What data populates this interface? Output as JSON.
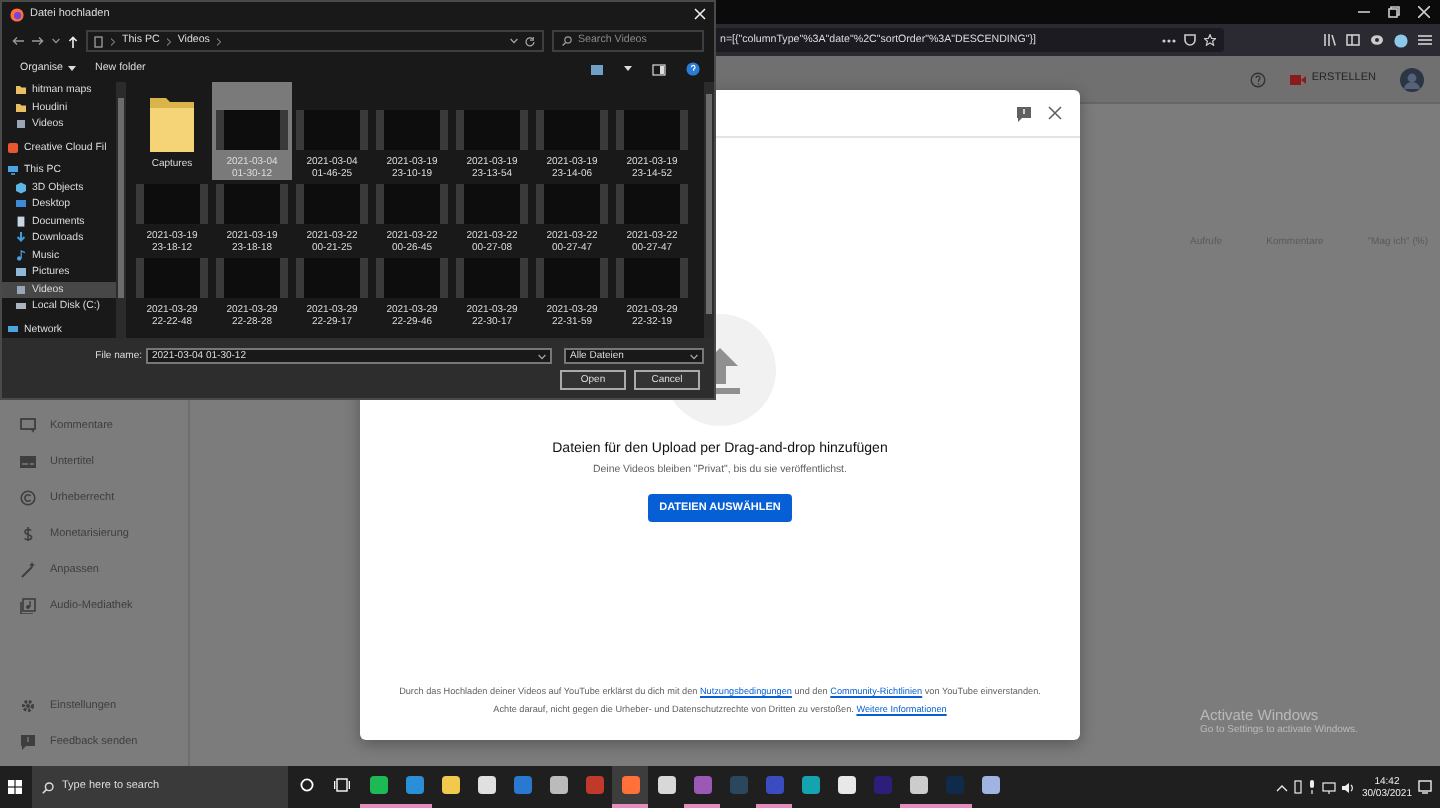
{
  "browser": {
    "url": "n=[{\"columnType\"%3A\"date\"%2C\"sortOrder\"%3A\"DESCENDING\"}]"
  },
  "studio": {
    "create_button": "ERSTELLEN",
    "sidebar_items": [
      {
        "label": "Kommentare"
      },
      {
        "label": "Untertitel"
      },
      {
        "label": "Urheberrecht"
      },
      {
        "label": "Monetarisierung"
      },
      {
        "label": "Anpassen"
      },
      {
        "label": "Audio-Mediathek"
      }
    ],
    "bottom_items": [
      {
        "label": "Einstellungen"
      },
      {
        "label": "Feedback senden"
      }
    ],
    "columns": [
      "Aufrufe",
      "Kommentare",
      "\"Mag ich\" (%)"
    ]
  },
  "upload_dialog": {
    "headline": "Dateien für den Upload per Drag-and-drop hinzufügen",
    "subline": "Deine Videos bleiben \"Privat\", bis du sie veröffentlichst.",
    "button": "DATEIEN AUSWÄHLEN",
    "footer": [
      [
        {
          "text": "Durch das Hochladen deiner Videos auf YouTube erklärst du dich mit den ",
          "link": false
        },
        {
          "text": "Nutzungsbedingungen",
          "link": true
        },
        {
          "text": " und den ",
          "link": false
        },
        {
          "text": "Community-Richtlinien",
          "link": true
        },
        {
          "text": " von YouTube einverstanden.",
          "link": false
        }
      ],
      [
        {
          "text": "Achte darauf, nicht gegen die Urheber- und Datenschutzrechte von Dritten zu verstoßen. ",
          "link": false
        },
        {
          "text": "Weitere Informationen",
          "link": true
        }
      ]
    ]
  },
  "file_dialog": {
    "title": "Datei hochladen",
    "breadcrumb": [
      "This PC",
      "Videos"
    ],
    "search_placeholder": "Search Videos",
    "toolbar": [
      "Organise",
      "New folder"
    ],
    "nav": [
      {
        "label": "hitman maps",
        "kind": "folder",
        "selected": false
      },
      {
        "label": "Houdini",
        "kind": "folder",
        "selected": false
      },
      {
        "label": "Videos",
        "kind": "videos",
        "selected": false
      },
      {
        "label": "Creative Cloud Fil",
        "kind": "cloud",
        "selected": false
      },
      {
        "label": "This PC",
        "kind": "pc",
        "selected": false,
        "children": [
          {
            "label": "3D Objects",
            "kind": "objects",
            "selected": false
          },
          {
            "label": "Desktop",
            "kind": "desktop",
            "selected": false
          },
          {
            "label": "Documents",
            "kind": "documents",
            "selected": false
          },
          {
            "label": "Downloads",
            "kind": "downloads",
            "selected": false
          },
          {
            "label": "Music",
            "kind": "music",
            "selected": false
          },
          {
            "label": "Pictures",
            "kind": "pictures",
            "selected": false
          },
          {
            "label": "Videos",
            "kind": "videos",
            "selected": true
          },
          {
            "label": "Local Disk (C:)",
            "kind": "disk",
            "selected": false
          }
        ]
      },
      {
        "label": "Network",
        "kind": "network",
        "selected": false
      }
    ],
    "files": [
      {
        "name": "Captures",
        "kind": "folder",
        "selected": false
      },
      {
        "name": "2021-03-04 01-30-12",
        "kind": "video",
        "selected": true
      },
      {
        "name": "2021-03-04 01-46-25",
        "kind": "video",
        "selected": false
      },
      {
        "name": "2021-03-19 23-10-19",
        "kind": "video",
        "selected": false
      },
      {
        "name": "2021-03-19 23-13-54",
        "kind": "video",
        "selected": false
      },
      {
        "name": "2021-03-19 23-14-06",
        "kind": "video",
        "selected": false
      },
      {
        "name": "2021-03-19 23-14-52",
        "kind": "video",
        "selected": false
      },
      {
        "name": "2021-03-19 23-18-12",
        "kind": "video",
        "selected": false
      },
      {
        "name": "2021-03-19 23-18-18",
        "kind": "video",
        "selected": false
      },
      {
        "name": "2021-03-22 00-21-25",
        "kind": "video",
        "selected": false
      },
      {
        "name": "2021-03-22 00-26-45",
        "kind": "video",
        "selected": false
      },
      {
        "name": "2021-03-22 00-27-08",
        "kind": "video",
        "selected": false
      },
      {
        "name": "2021-03-22 00-27-47",
        "kind": "video",
        "selected": false
      },
      {
        "name": "2021-03-22 00-27-47",
        "kind": "video",
        "selected": false
      },
      {
        "name": "2021-03-29 22-22-48",
        "kind": "video",
        "selected": false
      },
      {
        "name": "2021-03-29 22-28-28",
        "kind": "video",
        "selected": false
      },
      {
        "name": "2021-03-29 22-29-17",
        "kind": "video",
        "selected": false
      },
      {
        "name": "2021-03-29 22-29-46",
        "kind": "video",
        "selected": false
      },
      {
        "name": "2021-03-29 22-30-17",
        "kind": "video",
        "selected": false
      },
      {
        "name": "2021-03-29 22-31-59",
        "kind": "video",
        "selected": false
      },
      {
        "name": "2021-03-29 22-32-19",
        "kind": "video",
        "selected": false
      }
    ],
    "file_name_label": "File name:",
    "file_name": "2021-03-04 01-30-12",
    "file_type": "Alle Dateien",
    "buttons": [
      "Open",
      "Cancel"
    ]
  },
  "activation_notice": {
    "title": "Activate Windows",
    "subtitle": "Go to Settings to activate Windows."
  },
  "taskbar": {
    "search_placeholder": "Type here to search",
    "time": "14:42",
    "date": "30/03/2021",
    "apps": [
      {
        "running": true,
        "active": false
      },
      {
        "running": true,
        "active": false
      },
      {
        "running": false,
        "active": false
      },
      {
        "running": false,
        "active": false
      },
      {
        "running": false,
        "active": false
      },
      {
        "running": false,
        "active": false
      },
      {
        "running": false,
        "active": false
      },
      {
        "running": true,
        "active": true
      },
      {
        "running": false,
        "active": false
      },
      {
        "running": true,
        "active": false
      },
      {
        "running": false,
        "active": false
      },
      {
        "running": true,
        "active": false
      },
      {
        "running": false,
        "active": false
      },
      {
        "running": false,
        "active": false
      },
      {
        "running": false,
        "active": false
      },
      {
        "running": true,
        "active": false
      },
      {
        "running": true,
        "active": false
      },
      {
        "running": false,
        "active": false
      }
    ]
  }
}
